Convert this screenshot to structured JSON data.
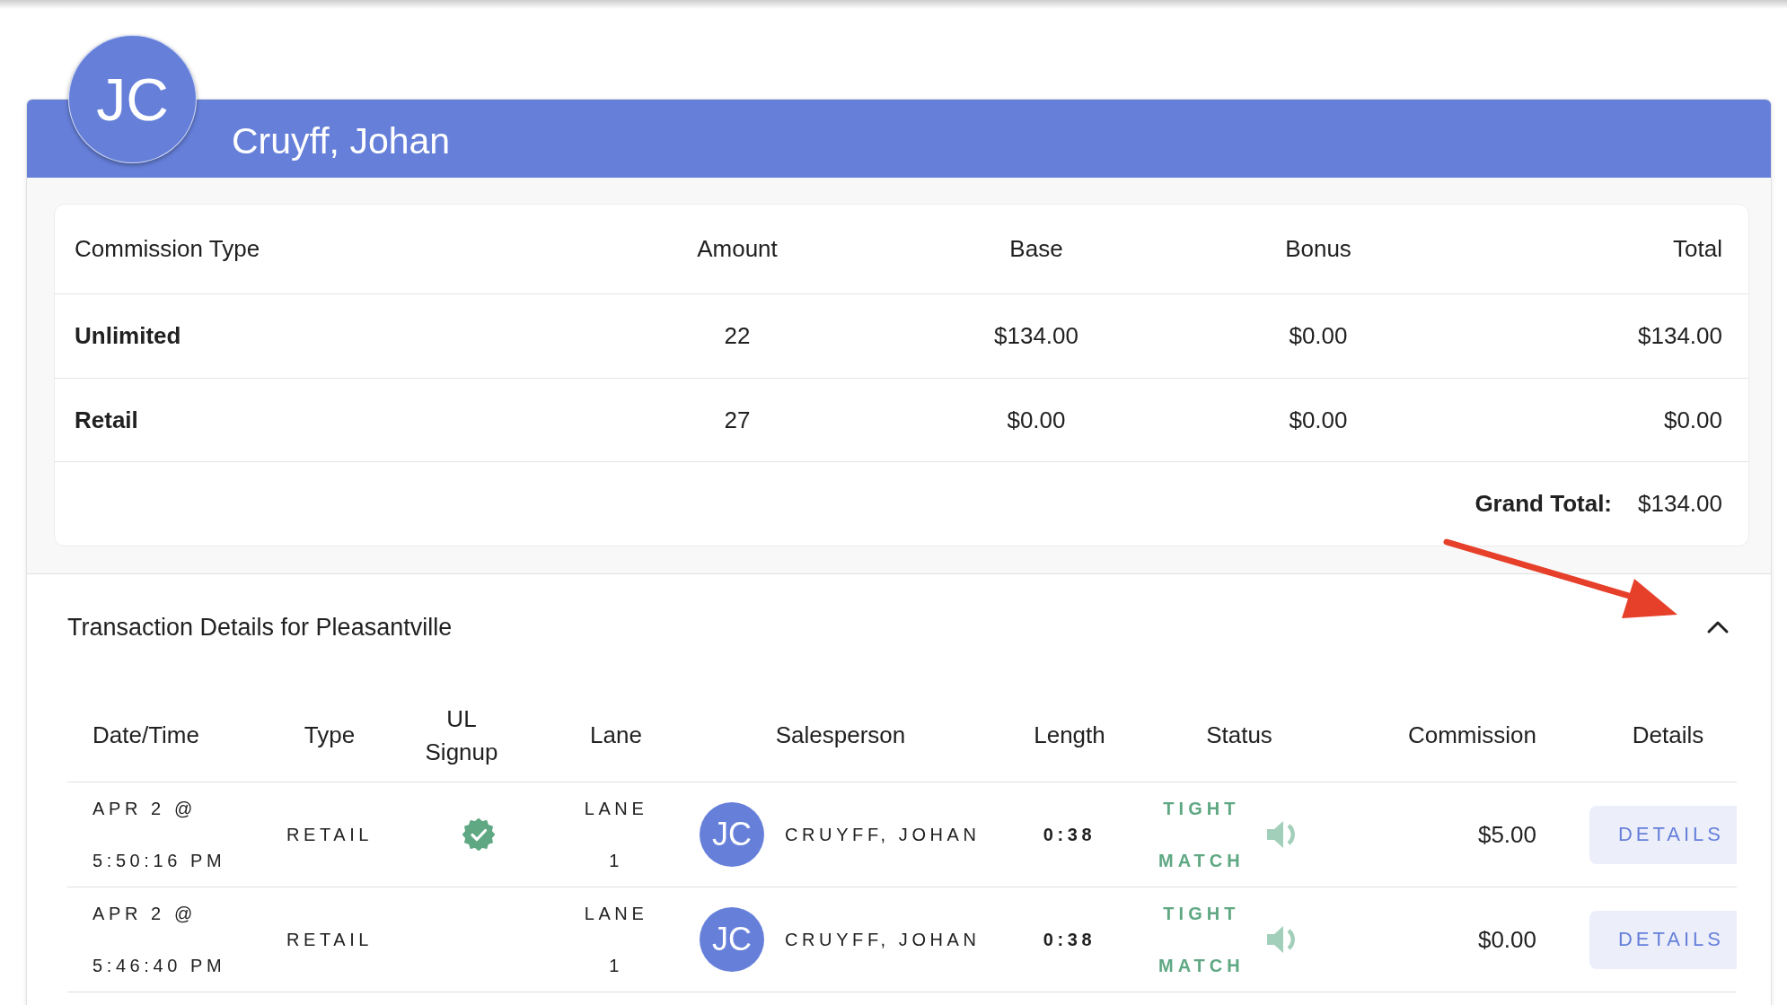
{
  "employee": {
    "initials": "JC",
    "name": "Cruyff, Johan"
  },
  "commission_summary": {
    "columns": [
      "Commission Type",
      "Amount",
      "Base",
      "Bonus",
      "Total"
    ],
    "rows": [
      {
        "type": "Unlimited",
        "amount": "22",
        "base": "$134.00",
        "bonus": "$0.00",
        "total": "$134.00"
      },
      {
        "type": "Retail",
        "amount": "27",
        "base": "$0.00",
        "bonus": "$0.00",
        "total": "$0.00"
      }
    ],
    "grand_total": {
      "label": "Grand Total:",
      "value": "$134.00"
    }
  },
  "transaction_section": {
    "title": "Transaction Details for Pleasantville",
    "expanded": true,
    "columns": [
      "Date/Time",
      "Type",
      "UL Signup",
      "Lane",
      "Salesperson",
      "Length",
      "Status",
      "Commission",
      "Details"
    ],
    "rows": [
      {
        "date_time": "APR 2 @ 5:50:16 PM",
        "type": "RETAIL",
        "ul_signup": true,
        "lane": "LANE 1",
        "salesperson": {
          "initials": "JC",
          "name": "CRUYFF, JOHAN"
        },
        "length": "0:38",
        "status": "TIGHT MATCH",
        "commission": "$5.00",
        "details_button": "DETAILS"
      },
      {
        "date_time": "APR 2 @ 5:46:40 PM",
        "type": "RETAIL",
        "ul_signup": false,
        "lane": "LANE 1",
        "salesperson": {
          "initials": "JC",
          "name": "CRUYFF, JOHAN"
        },
        "length": "0:38",
        "status": "TIGHT MATCH",
        "commission": "$0.00",
        "details_button": "DETAILS"
      }
    ]
  }
}
